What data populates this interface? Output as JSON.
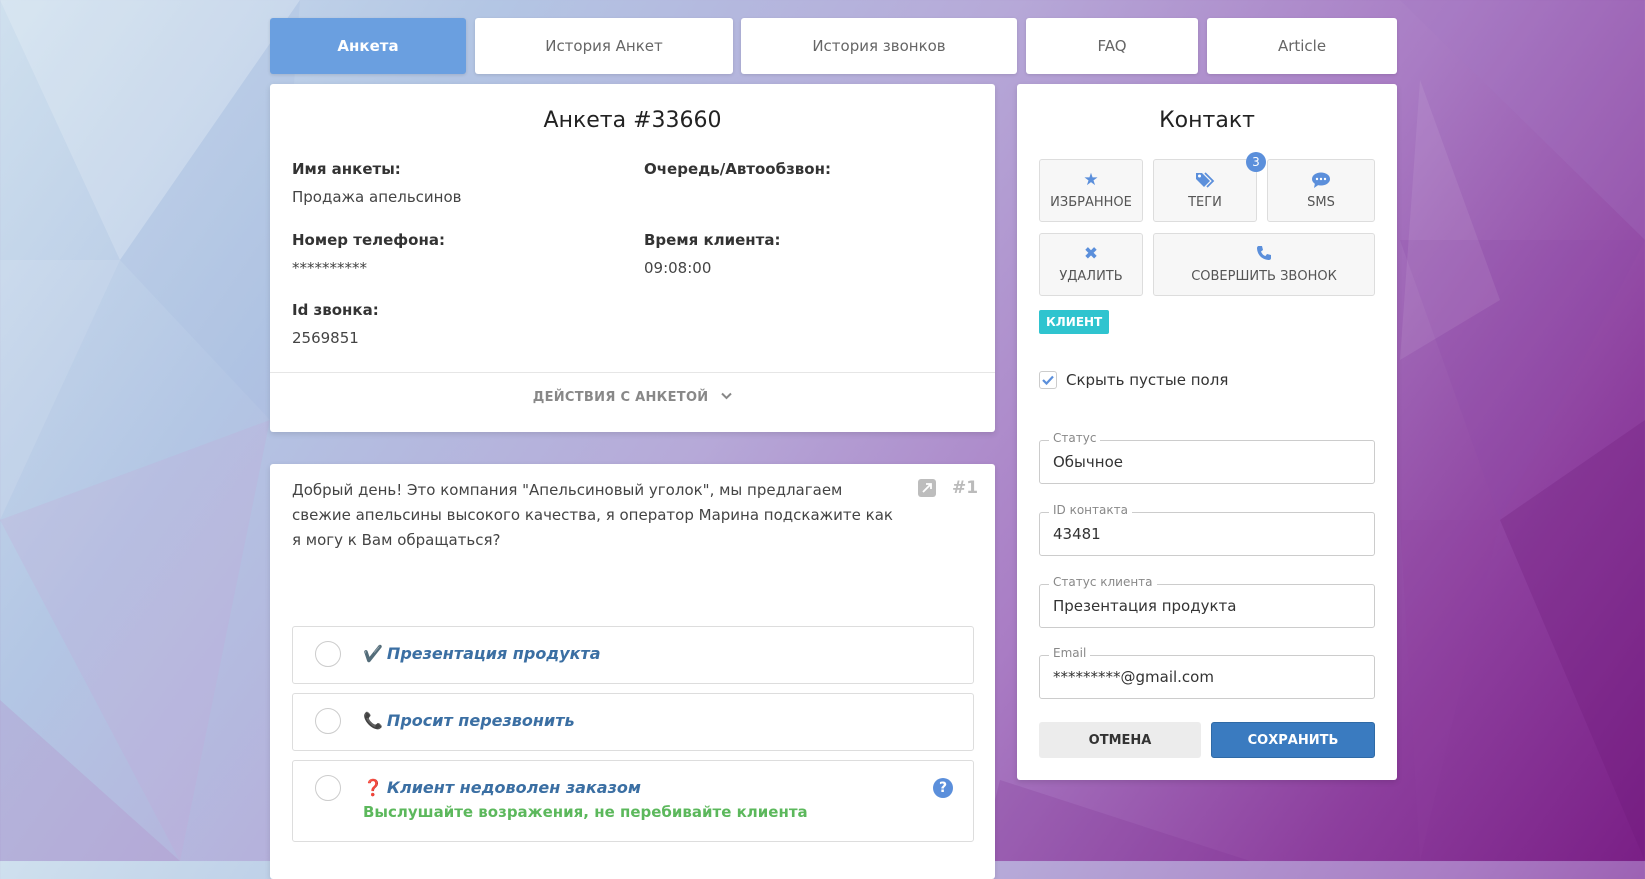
{
  "tabs": [
    {
      "label": "Анкета",
      "active": true
    },
    {
      "label": "История Анкет"
    },
    {
      "label": "История звонков"
    },
    {
      "label": "FAQ"
    },
    {
      "label": "Article"
    }
  ],
  "anketa": {
    "title": "Анкета #33660",
    "fields": {
      "name_label": "Имя анкеты:",
      "name_value": "Продажа апельсинов",
      "queue_label": "Очередь/Автообзвон:",
      "phone_label": "Номер телефона:",
      "phone_value": "**********",
      "client_time_label": "Время клиента:",
      "client_time_value": "09:08:00",
      "call_id_label": "Id звонка:",
      "call_id_value": "2569851"
    },
    "actions_label": "ДЕЙСТВИЯ С АНКЕТОЙ"
  },
  "question": {
    "text": "Добрый день! Это компания \"Апельсиновый уголок\", мы предлагаем свежие апельсины высокого качества, я оператор Марина подскажите как я могу к Вам обращаться?",
    "number": "#1",
    "options": [
      {
        "emoji": "✔️",
        "label": "Презентация продукта"
      },
      {
        "emoji": "📞",
        "label": "Просит перезвонить"
      },
      {
        "emoji": "❓",
        "label": "Клиент недоволен заказом",
        "hint": "Выслушайте возражения, не перебивайте клиента"
      }
    ]
  },
  "contact": {
    "title": "Контакт",
    "buttons": {
      "favorite": "ИЗБРАННОЕ",
      "tags": "ТЕГИ",
      "tags_count": "3",
      "sms": "SMS",
      "delete": "УДАЛИТЬ",
      "call": "СОВЕРШИТЬ ЗВОНОК"
    },
    "client_tag": "КЛИЕНТ",
    "hide_empty_label": "Скрыть пустые поля",
    "hide_empty_checked": true,
    "status_label": "Статус",
    "status_value": "Обычное",
    "id_label": "ID контакта",
    "id_value": "43481",
    "client_status_label": "Статус клиента",
    "client_status_value": "Презентация продукта",
    "email_label": "Email",
    "email_value": "*********@gmail.com",
    "cancel": "ОТМЕНА",
    "save": "СОХРАНИТЬ"
  },
  "colors": {
    "accent": "#6a9fe0",
    "primary_button": "#3a7bc0",
    "client_tag": "#2fc4cf",
    "hint_green": "#5cb85c",
    "option_text": "#3b6fa3"
  }
}
